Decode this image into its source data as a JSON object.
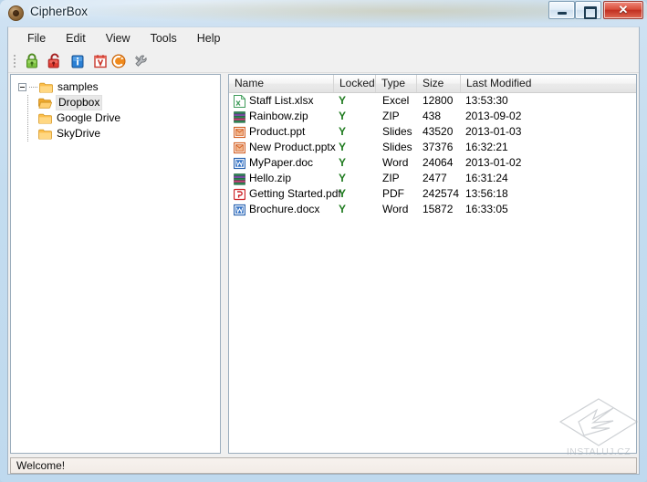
{
  "window": {
    "title": "CipherBox",
    "app_icon": "cipherbox-app-icon",
    "caption": {
      "minimize": "minimize-icon",
      "maximize": "maximize-icon",
      "close": "✕"
    }
  },
  "menubar": {
    "items": [
      {
        "label": "File",
        "name": "menu-file"
      },
      {
        "label": "Edit",
        "name": "menu-edit"
      },
      {
        "label": "View",
        "name": "menu-view"
      },
      {
        "label": "Tools",
        "name": "menu-tools"
      },
      {
        "label": "Help",
        "name": "menu-help"
      }
    ]
  },
  "toolbar": {
    "buttons": [
      {
        "name": "lock-icon",
        "tip": "Lock"
      },
      {
        "name": "unlock-icon",
        "tip": "Unlock"
      },
      {
        "name": "info-icon",
        "tip": "Info"
      },
      {
        "name": "calendar-icon",
        "tip": "Shred"
      },
      {
        "name": "refresh-icon",
        "tip": "Refresh"
      },
      {
        "name": "settings-wrench-icon",
        "tip": "Settings"
      }
    ]
  },
  "tree": {
    "root": {
      "label": "samples",
      "expanded": true
    },
    "children": [
      {
        "label": "Dropbox",
        "selected": true
      },
      {
        "label": "Google Drive",
        "selected": false
      },
      {
        "label": "SkyDrive",
        "selected": false
      }
    ]
  },
  "filelist": {
    "columns": [
      "Name",
      "Locked",
      "Type",
      "Size",
      "Last Modified"
    ],
    "rows": [
      {
        "name": "Staff List.xlsx",
        "locked": "Y",
        "type": "Excel",
        "size": "12800",
        "modified": "13:53:30",
        "icon": "excel-file-icon"
      },
      {
        "name": "Rainbow.zip",
        "locked": "Y",
        "type": "ZIP",
        "size": "438",
        "modified": "2013-09-02",
        "icon": "zip-file-icon"
      },
      {
        "name": "Product.ppt",
        "locked": "Y",
        "type": "Slides",
        "size": "43520",
        "modified": "2013-01-03",
        "icon": "powerpoint-file-icon"
      },
      {
        "name": "New Product.pptx",
        "locked": "Y",
        "type": "Slides",
        "size": "37376",
        "modified": "16:32:21",
        "icon": "powerpoint-file-icon"
      },
      {
        "name": "MyPaper.doc",
        "locked": "Y",
        "type": "Word",
        "size": "24064",
        "modified": "2013-01-02",
        "icon": "word-file-icon"
      },
      {
        "name": "Hello.zip",
        "locked": "Y",
        "type": "ZIP",
        "size": "2477",
        "modified": "16:31:24",
        "icon": "zip-file-icon"
      },
      {
        "name": "Getting Started.pdf",
        "locked": "Y",
        "type": "PDF",
        "size": "242574",
        "modified": "13:56:18",
        "icon": "pdf-file-icon"
      },
      {
        "name": "Brochure.docx",
        "locked": "Y",
        "type": "Word",
        "size": "15872",
        "modified": "16:33:05",
        "icon": "word-file-icon"
      }
    ]
  },
  "statusbar": {
    "message": "Welcome!"
  },
  "watermark": {
    "text": "INSTALUJ.CZ"
  },
  "colors": {
    "locked_green": "#1e7a1e",
    "titlebar_blue": "#bfd9ee",
    "close_red": "#c13022"
  }
}
